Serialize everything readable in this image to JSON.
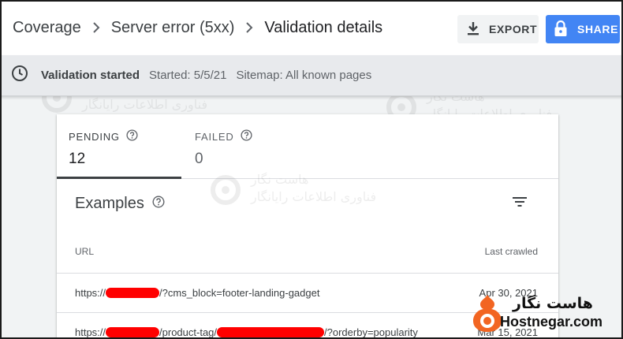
{
  "breadcrumb": {
    "items": [
      "Coverage",
      "Server error (5xx)",
      "Validation details"
    ]
  },
  "actions": {
    "export_label": "EXPORT",
    "share_label": "SHARE"
  },
  "status": {
    "title": "Validation started",
    "started": "Started: 5/5/21",
    "sitemap": "Sitemap: All known pages"
  },
  "tabs": [
    {
      "label": "PENDING",
      "value": "12"
    },
    {
      "label": "FAILED",
      "value": "0"
    }
  ],
  "examples": {
    "title": "Examples",
    "columns": {
      "url": "URL",
      "last_crawled": "Last crawled"
    },
    "rows": [
      {
        "url_prefix": "https://",
        "url_suffix": "/?cms_block=footer-landing-gadget",
        "last_crawled": "Apr 30, 2021"
      },
      {
        "url_prefix": "https://",
        "url_mid": "/product-tag/",
        "url_suffix": "/?orderby=popularity",
        "last_crawled": "Mar 15, 2021"
      }
    ]
  },
  "watermark": {
    "line1": "هاست نگار",
    "line2": "فناوری اطلاعات رایانگار"
  },
  "logo": {
    "persian": "هاست نگار",
    "english": "Hostnegar.com",
    "accent": "#f26522"
  },
  "colors": {
    "share_button": "#4285f4",
    "redaction": "#ff0000"
  },
  "icons": [
    "chevron-right-icon",
    "download-icon",
    "lock-icon",
    "clock-icon",
    "help-icon",
    "filter-icon"
  ]
}
